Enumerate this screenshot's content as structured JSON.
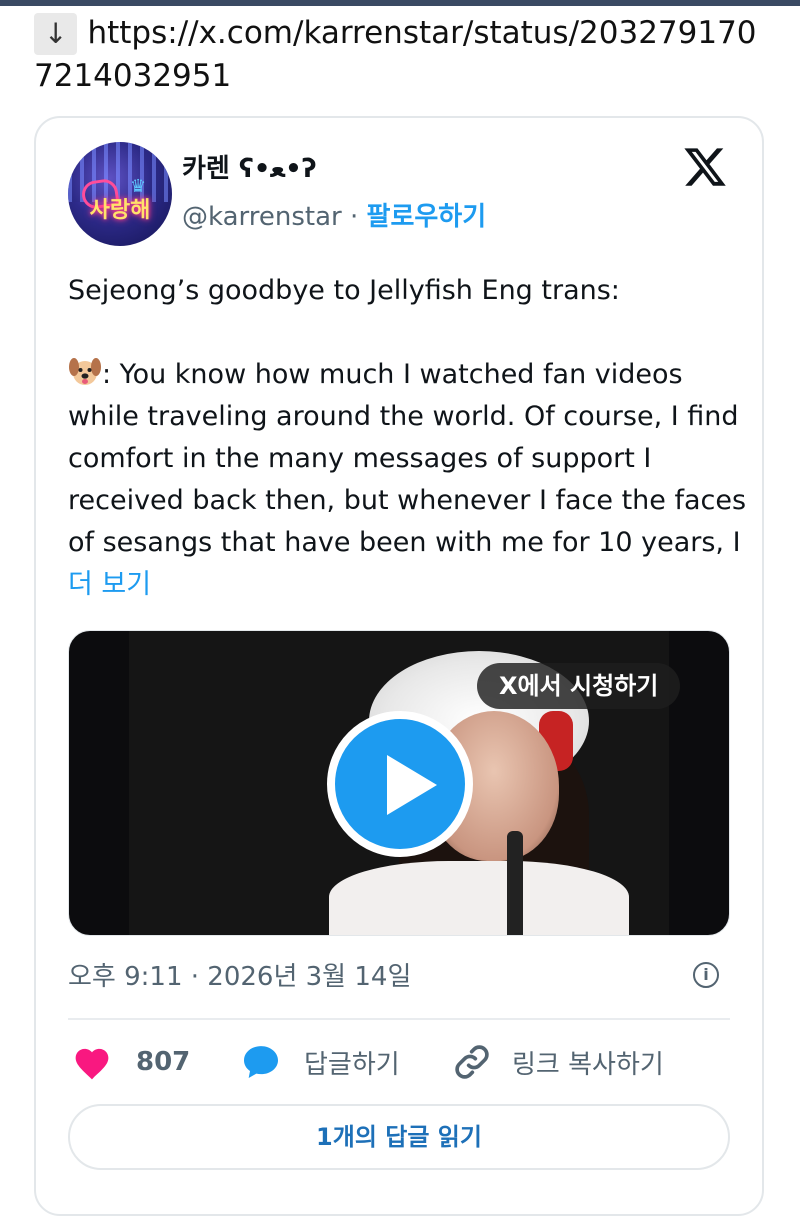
{
  "link": {
    "arrow": "↓",
    "url": "https://x.com/karrenstar/status/2032791707214032951"
  },
  "tweet": {
    "display_name": "카렌 ʕ•ﻌ•ʔ",
    "handle": "@karrenstar",
    "separator": " · ",
    "follow_label": "팔로우하기",
    "avatar_text": "사랑해",
    "line1": "Sejeong’s goodbye to Jellyfish Eng trans:",
    "body": ": You know how much I watched fan videos while traveling around the world. Of course, I find comfort in the many messages of support I received back then, but whenever I face the faces of sesangs that have been with me for 10 years, I ",
    "more_label": "더 보기",
    "watch_label": "X에서 시청하기",
    "timestamp": "오후 9:11 · 2026년 3월 14일",
    "likes": "807",
    "reply_label": "답글하기",
    "copy_link_label": "링크 복사하기",
    "read_replies_label": "1개의 답글 읽기"
  },
  "colors": {
    "accent": "#1d9bf0",
    "like": "#f91880",
    "text": "#0f1419",
    "muted": "#536471"
  },
  "icons": {
    "logo": "x-logo-icon",
    "emoji": "dog-face-icon",
    "play": "play-icon",
    "info": "info-icon",
    "like": "heart-icon",
    "reply": "speech-bubble-icon",
    "link": "link-icon"
  }
}
